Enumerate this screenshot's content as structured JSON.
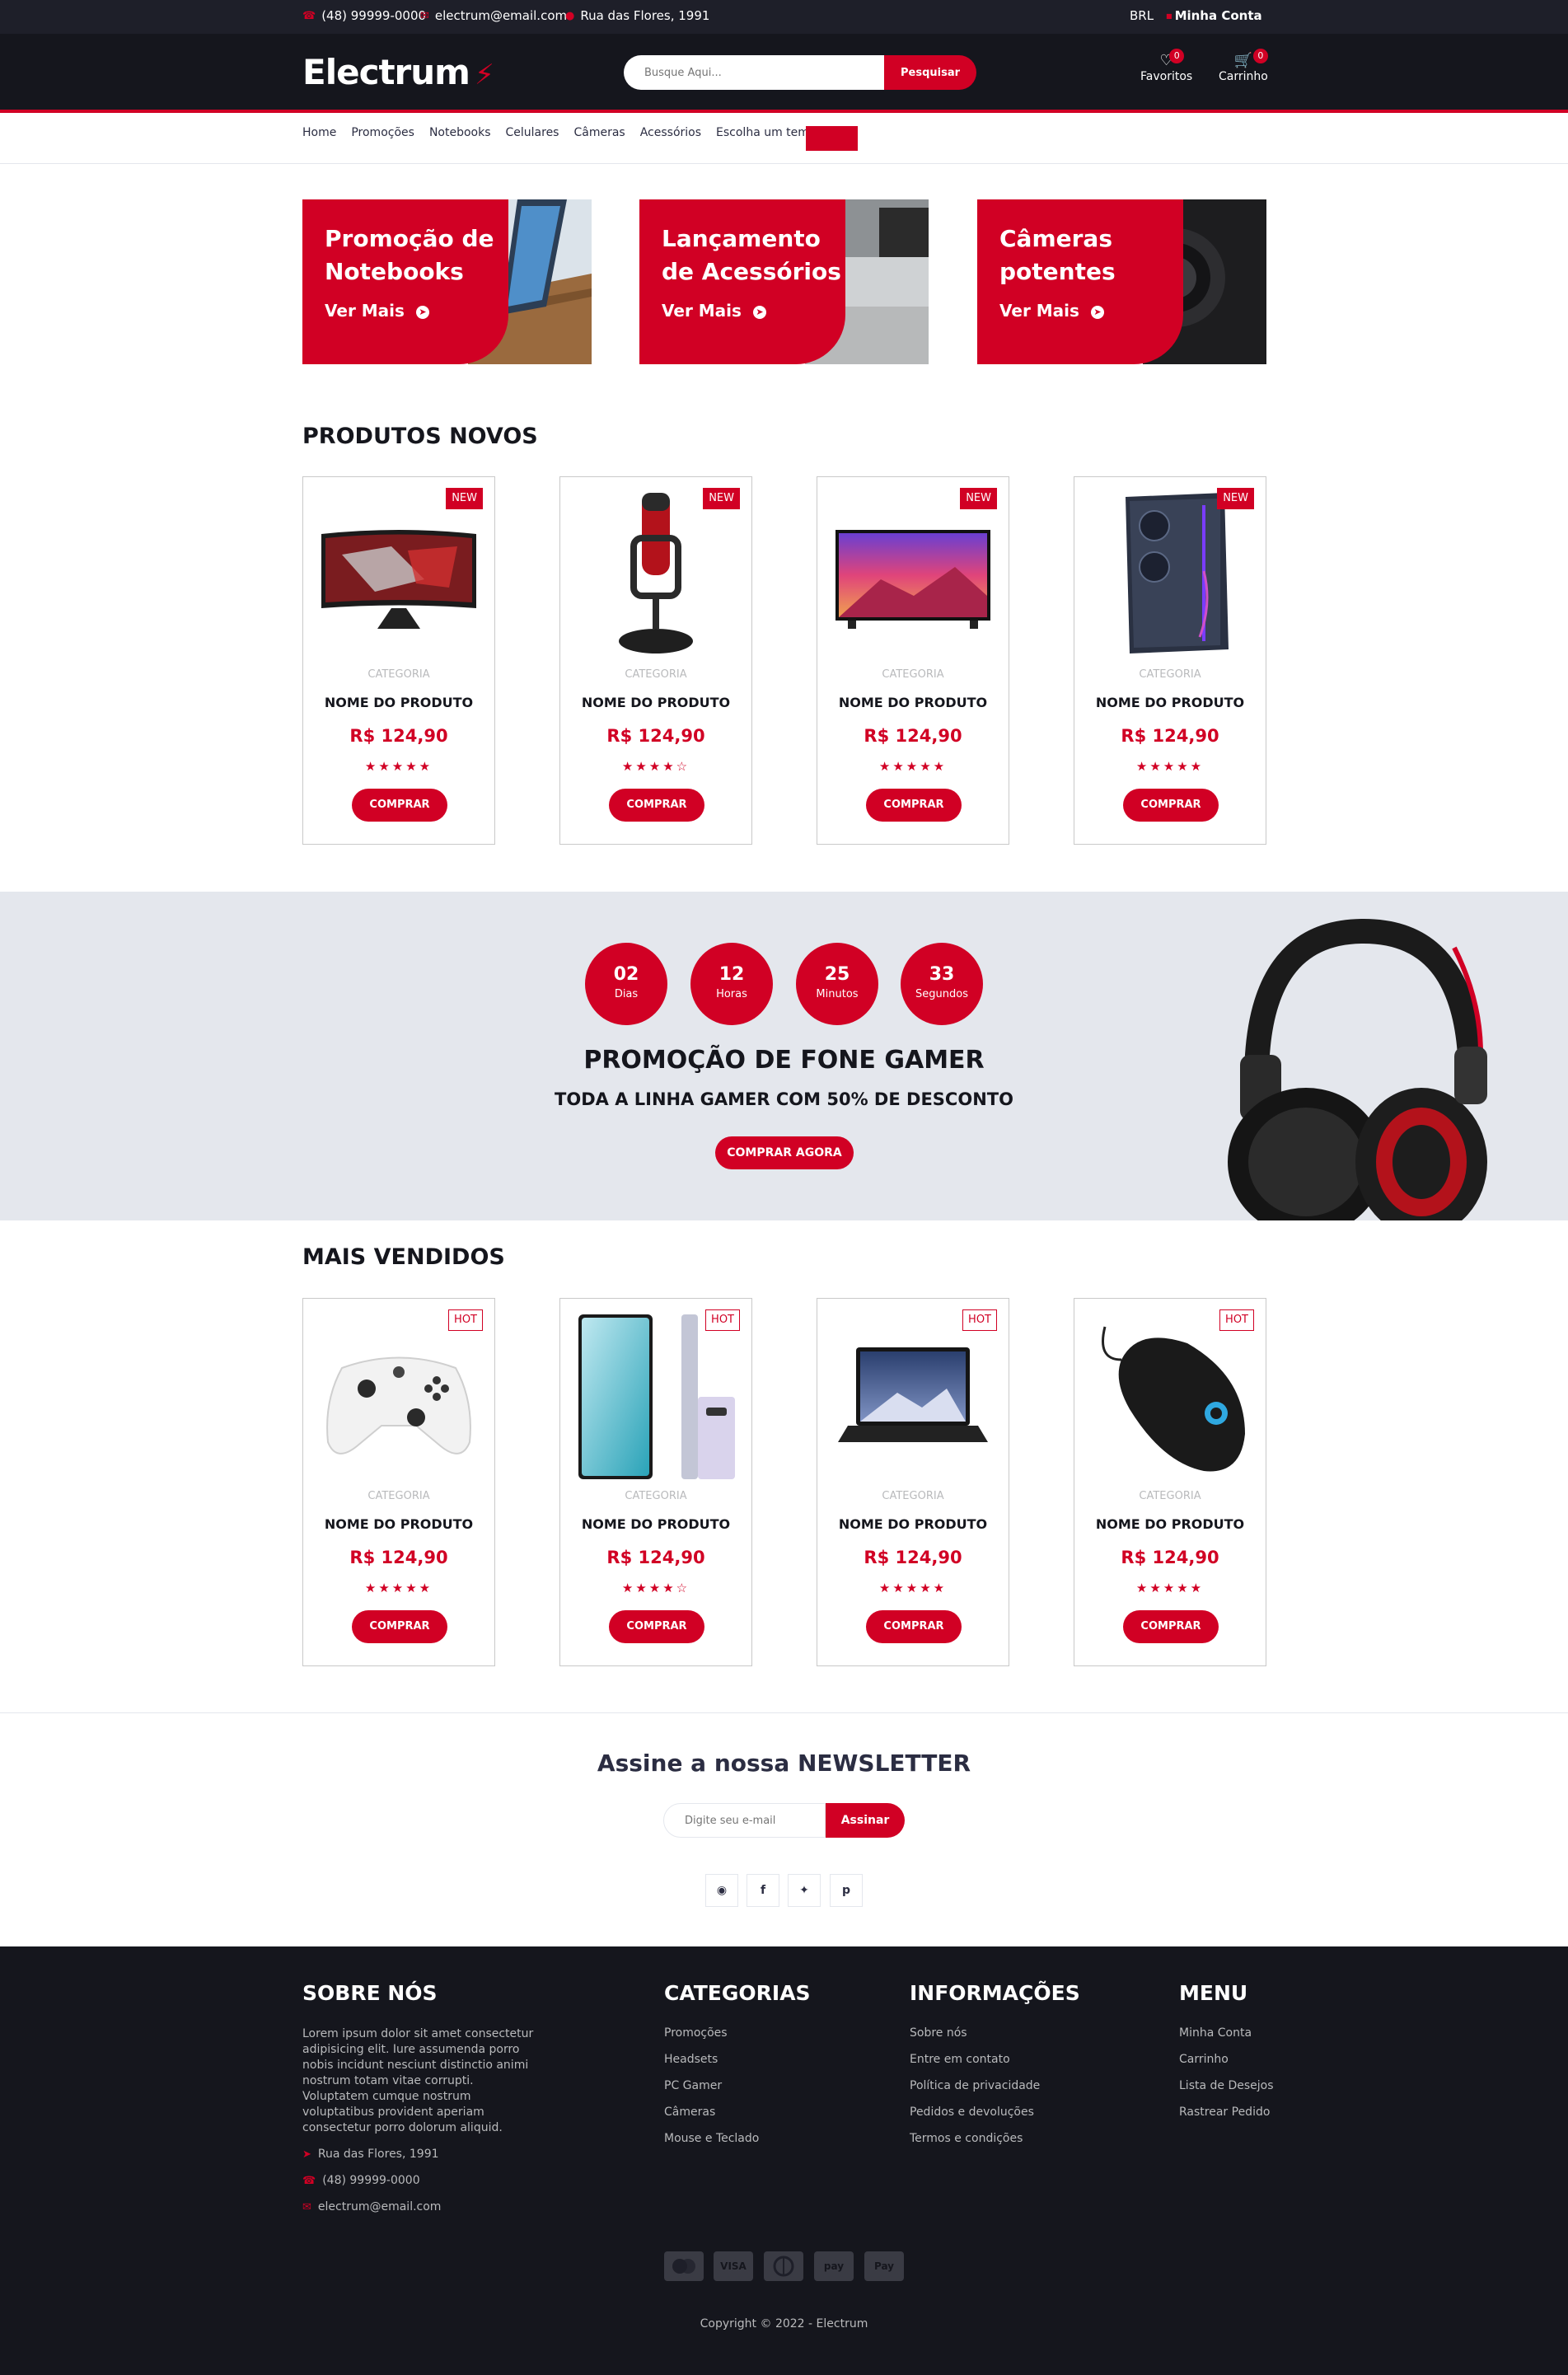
{
  "topbar": {
    "phone": "(48) 99999-0000",
    "email": "electrum@email.com",
    "address": "Rua das Flores, 1991",
    "currency": "BRL",
    "account": "Minha Conta"
  },
  "header": {
    "logo": "Electrum",
    "search_placeholder": "Busque Aqui...",
    "search_button": "Pesquisar",
    "favorites_label": "Favoritos",
    "favorites_count": "0",
    "cart_label": "Carrinho",
    "cart_count": "0"
  },
  "nav": {
    "items": [
      "Home",
      "Promoções",
      "Notebooks",
      "Celulares",
      "Câmeras",
      "Acessórios",
      "Escolha um tema"
    ]
  },
  "shops": [
    {
      "line1": "Promoção de",
      "line2": "Notebooks",
      "cta": "Ver Mais"
    },
    {
      "line1": "Lançamento",
      "line2": "de Acessórios",
      "cta": "Ver Mais"
    },
    {
      "line1": "Câmeras",
      "line2": "potentes",
      "cta": "Ver Mais"
    }
  ],
  "new_products": {
    "title": "PRODUTOS NOVOS",
    "items": [
      {
        "badge": "NEW",
        "category": "CATEGORIA",
        "name": "NOME DO PRODUTO",
        "price": "R$ 124,90",
        "rating": 5,
        "button": "COMPRAR",
        "image": "curved-monitor"
      },
      {
        "badge": "NEW",
        "category": "CATEGORIA",
        "name": "NOME DO PRODUTO",
        "price": "R$ 124,90",
        "rating": 4,
        "button": "COMPRAR",
        "image": "microphone"
      },
      {
        "badge": "NEW",
        "category": "CATEGORIA",
        "name": "NOME DO PRODUTO",
        "price": "R$ 124,90",
        "rating": 5,
        "button": "COMPRAR",
        "image": "tv"
      },
      {
        "badge": "NEW",
        "category": "CATEGORIA",
        "name": "NOME DO PRODUTO",
        "price": "R$ 124,90",
        "rating": 5,
        "button": "COMPRAR",
        "image": "pc-case"
      }
    ]
  },
  "hot_deal": {
    "countdown": [
      {
        "value": "02",
        "label": "Dias"
      },
      {
        "value": "12",
        "label": "Horas"
      },
      {
        "value": "25",
        "label": "Minutos"
      },
      {
        "value": "33",
        "label": "Segundos"
      }
    ],
    "title": "PROMOÇÃO DE FONE GAMER",
    "subtitle": "TODA A LINHA GAMER COM 50% DE DESCONTO",
    "button": "COMPRAR AGORA"
  },
  "best_sellers": {
    "title": "MAIS VENDIDOS",
    "items": [
      {
        "badge": "HOT",
        "category": "CATEGORIA",
        "name": "NOME DO PRODUTO",
        "price": "R$ 124,90",
        "rating": 5,
        "button": "COMPRAR",
        "image": "controller"
      },
      {
        "badge": "HOT",
        "category": "CATEGORIA",
        "name": "NOME DO PRODUTO",
        "price": "R$ 124,90",
        "rating": 4,
        "button": "COMPRAR",
        "image": "phone"
      },
      {
        "badge": "HOT",
        "category": "CATEGORIA",
        "name": "NOME DO PRODUTO",
        "price": "R$ 124,90",
        "rating": 5,
        "button": "COMPRAR",
        "image": "laptop"
      },
      {
        "badge": "HOT",
        "category": "CATEGORIA",
        "name": "NOME DO PRODUTO",
        "price": "R$ 124,90",
        "rating": 5,
        "button": "COMPRAR",
        "image": "mouse"
      }
    ]
  },
  "newsletter": {
    "title": "Assine a nossa NEWSLETTER",
    "placeholder": "Digite seu e-mail",
    "button": "Assinar",
    "social": [
      "instagram-icon",
      "facebook-icon",
      "twitter-icon",
      "pinterest-icon"
    ]
  },
  "footer": {
    "about": {
      "title": "SOBRE NÓS",
      "text": "Lorem ipsum dolor sit amet consectetur adipisicing elit. Iure assumenda porro nobis incidunt nesciunt distinctio animi nostrum totam vitae corrupti. Voluptatem cumque nostrum voluptatibus provident aperiam consectetur porro dolorum aliquid.",
      "address": "Rua das Flores, 1991",
      "phone": "(48) 99999-0000",
      "email": "electrum@email.com"
    },
    "categories": {
      "title": "CATEGORIAS",
      "links": [
        "Promoções",
        "Headsets",
        "PC Gamer",
        "Câmeras",
        "Mouse e Teclado"
      ]
    },
    "info": {
      "title": "INFORMAÇÕES",
      "links": [
        "Sobre nós",
        "Entre em contato",
        "Política de privacidade",
        "Pedidos e devoluções",
        "Termos e condições"
      ]
    },
    "menu": {
      "title": "MENU",
      "links": [
        "Minha Conta",
        "Carrinho",
        "Lista de Desejos",
        "Rastrear Pedido"
      ]
    },
    "payment_icons": [
      "mastercard-icon",
      "visa-icon",
      "diners-icon",
      "amazon-pay-icon",
      "apple-pay-icon"
    ],
    "payment_labels": [
      "",
      "VISA",
      "",
      "pay",
      "Pay"
    ],
    "copyright": "Copyright © 2022 - Electrum"
  },
  "colors": {
    "accent": "#d10024",
    "dark": "#15161d",
    "topbar": "#1e1f29",
    "light_bg": "#e4e7ed"
  }
}
